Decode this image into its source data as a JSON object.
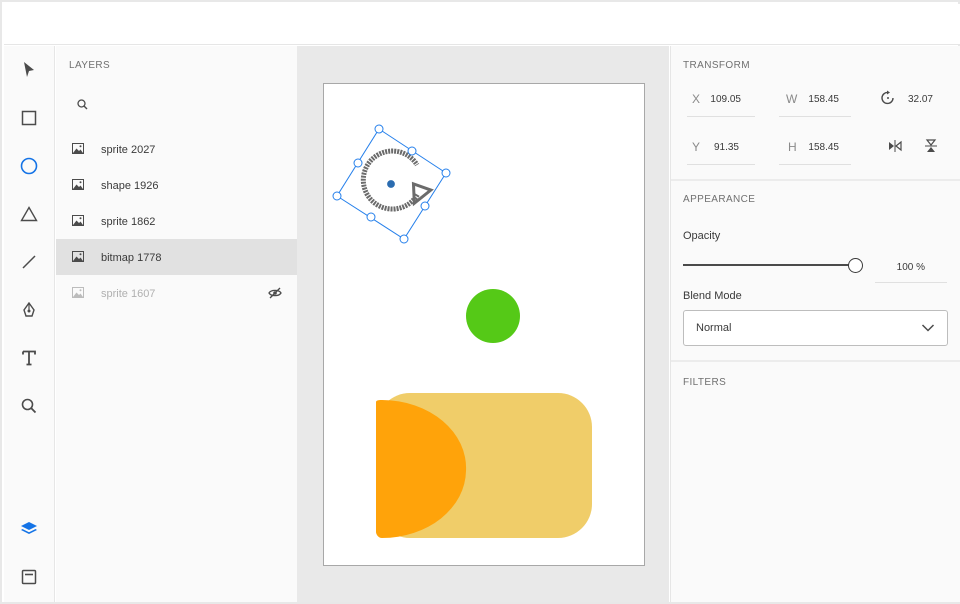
{
  "layers_panel": {
    "title": "LAYERS",
    "search_placeholder": "",
    "items": [
      {
        "label": "sprite 2027",
        "selected": false,
        "hidden": false
      },
      {
        "label": "shape 1926",
        "selected": false,
        "hidden": false
      },
      {
        "label": "sprite 1862",
        "selected": false,
        "hidden": false
      },
      {
        "label": "bitmap 1778",
        "selected": true,
        "hidden": false
      },
      {
        "label": "sprite 1607",
        "selected": false,
        "hidden": true
      }
    ]
  },
  "toolbar": {
    "tools": [
      "select-arrow-icon",
      "rectangle-icon",
      "ellipse-icon",
      "triangle-icon",
      "line-icon",
      "pen-icon",
      "text-icon",
      "zoom-icon"
    ],
    "active_tool": "ellipse-icon",
    "bottom": [
      "layers-icon",
      "library-icon"
    ]
  },
  "transform": {
    "title": "TRANSFORM",
    "x_label": "X",
    "x_value": "109.05",
    "w_label": "W",
    "w_value": "158.45",
    "rotation_value": "32.07",
    "y_label": "Y",
    "y_value": "91.35",
    "h_label": "H",
    "h_value": "158.45"
  },
  "appearance": {
    "title": "APPEARANCE",
    "opacity_label": "Opacity",
    "opacity_value": "100 %",
    "opacity_level": 1.0,
    "blend_label": "Blend Mode",
    "blend_value": "Normal"
  },
  "filters": {
    "title": "FILTERS"
  },
  "colors": {
    "accent": "#1473e6",
    "selection": "#2680eb",
    "green_circle": "#55c917",
    "orange": "#ffa30a",
    "yellow": "#f0cd69"
  }
}
